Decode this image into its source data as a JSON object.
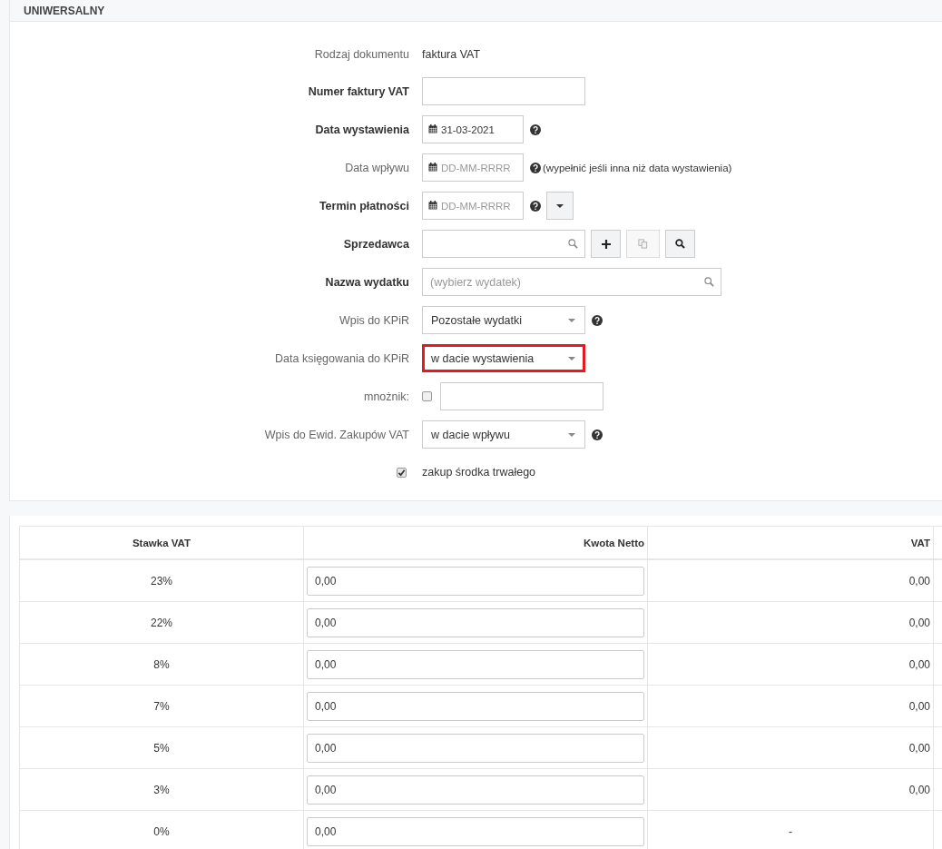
{
  "panel": {
    "title": "UNIWERSALNY"
  },
  "form": [
    {
      "kind": "text",
      "label": "Rodzaj dokumentu",
      "bold": false,
      "value": "faktura VAT"
    },
    {
      "kind": "input",
      "label": "Numer faktury VAT",
      "bold": true
    },
    {
      "kind": "date",
      "label": "Data wystawienia",
      "bold": true,
      "value": "31-03-2021",
      "help": true
    },
    {
      "kind": "date",
      "label": "Data wpływu",
      "bold": false,
      "placeholder": "DD-MM-RRRR",
      "help": true,
      "note": "(wypełnić jeśli inna niż data wystawienia)"
    },
    {
      "kind": "date",
      "label": "Termin płatności",
      "bold": true,
      "placeholder": "DD-MM-RRRR",
      "help": true,
      "dropdown": true
    },
    {
      "kind": "search",
      "label": "Sprzedawca",
      "bold": true,
      "buttons": [
        {
          "disabled": false
        },
        {
          "disabled": true
        },
        {
          "disabled": false
        }
      ]
    },
    {
      "kind": "search",
      "label": "Nazwa wydatku",
      "bold": true,
      "placeholder": "(wybierz wydatek)"
    },
    {
      "kind": "select",
      "label": "Wpis do KPiR",
      "bold": false,
      "value": "Pozostałe wydatki",
      "help": true,
      "highlighted": false
    },
    {
      "kind": "select",
      "label": "Data księgowania do KPiR",
      "bold": false,
      "value": "w dacie wystawienia",
      "help": false,
      "highlighted": true
    },
    {
      "kind": "checkbox-input",
      "label": "mnożnik:",
      "bold": false,
      "checked": false
    },
    {
      "kind": "select",
      "label": "Wpis do Ewid. Zakupów VAT",
      "bold": false,
      "value": "w dacie wpływu",
      "help": true,
      "highlighted": false
    },
    {
      "kind": "checkbox",
      "label": "zakup środka trwałego",
      "checked": true
    }
  ],
  "table": {
    "columns": [
      "Stawka VAT",
      "Kwota Netto",
      "VAT"
    ],
    "rows": [
      {
        "rate": "23%",
        "net": "0,00",
        "vat": "0,00"
      },
      {
        "rate": "22%",
        "net": "0,00",
        "vat": "0,00"
      },
      {
        "rate": "8%",
        "net": "0,00",
        "vat": "0,00"
      },
      {
        "rate": "7%",
        "net": "0,00",
        "vat": "0,00"
      },
      {
        "rate": "5%",
        "net": "0,00",
        "vat": "0,00"
      },
      {
        "rate": "3%",
        "net": "0,00",
        "vat": "0,00"
      },
      {
        "rate": "0%",
        "net": "0,00",
        "vat": "-"
      }
    ]
  }
}
